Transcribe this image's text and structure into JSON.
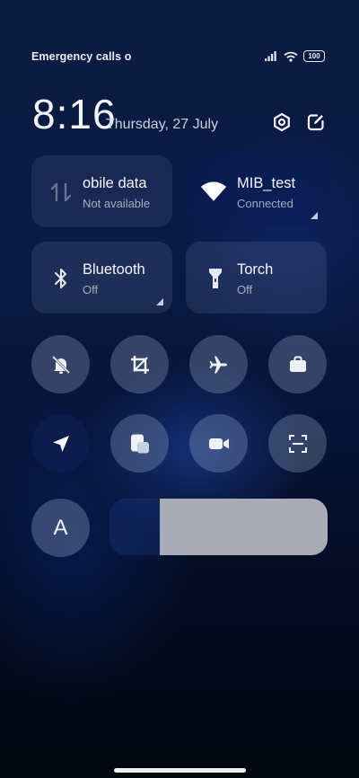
{
  "status_bar": {
    "carrier_text": "Emergency calls o",
    "battery": "100"
  },
  "header": {
    "time": "8:16",
    "date": "Thursday, 27 July"
  },
  "tiles": [
    {
      "title": "obile data",
      "subtitle": "Not available",
      "icon": "mobile-data-icon"
    },
    {
      "title": "MIB_test",
      "subtitle": "Connected",
      "icon": "wifi-icon"
    },
    {
      "title": "Bluetooth",
      "subtitle": "Off",
      "icon": "bluetooth-icon"
    },
    {
      "title": "Torch",
      "subtitle": "Off",
      "icon": "torch-icon"
    }
  ],
  "toggles": [
    {
      "icon": "mute-bell-icon"
    },
    {
      "icon": "crop-icon"
    },
    {
      "icon": "airplane-icon"
    },
    {
      "icon": "briefcase-icon"
    },
    {
      "icon": "location-icon"
    },
    {
      "icon": "overlay-icon"
    },
    {
      "icon": "video-camera-icon"
    },
    {
      "icon": "scanner-icon"
    }
  ],
  "auto_brightness": {
    "label": "A"
  },
  "brightness": {
    "level": 0.77
  },
  "colors": {
    "accent_fill": "#a9acb6"
  }
}
